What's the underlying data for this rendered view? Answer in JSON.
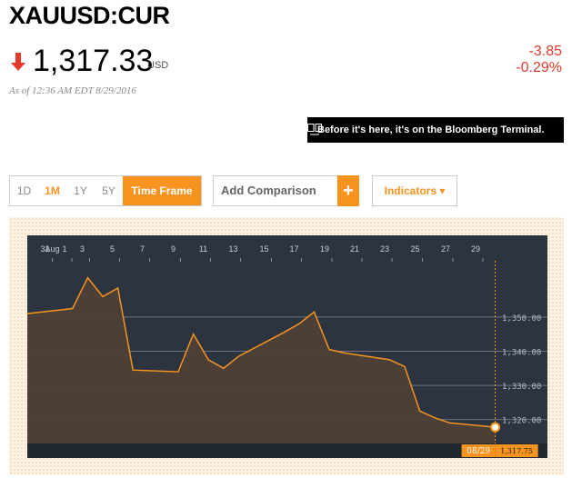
{
  "ticker": "XAUUSD:CUR",
  "price": "1,317.33",
  "currency": "USD",
  "change": "-3.85",
  "change_pct": "-0.29%",
  "as_of": "As of 12:36 AM EDT 8/29/2016",
  "promo": {
    "text": "Before it's here, it's on the Bloomberg Terminal."
  },
  "ranges": [
    "1D",
    "1M",
    "1Y",
    "5Y"
  ],
  "active_range": "1M",
  "time_frame_label": "Time Frame",
  "comparison": {
    "placeholder": "Add Comparison"
  },
  "plus_label": "+",
  "indicators_label": "Indicators ▾",
  "colors": {
    "accent": "#f7931e",
    "down": "#e33a2c",
    "plot_bg": "#2c3440",
    "area": "#4d4037"
  },
  "chart_data": {
    "type": "area",
    "x_tick_labels": [
      "31",
      "Aug",
      "1",
      "3",
      "5",
      "7",
      "9",
      "11",
      "13",
      "15",
      "17",
      "19",
      "21",
      "23",
      "25",
      "27",
      "29"
    ],
    "y_tick_labels": [
      "1,350.00",
      "1,340.00",
      "1,330.00",
      "1,320.00"
    ],
    "ylim": [
      1313,
      1367
    ],
    "x": [
      "07/29",
      "08/01",
      "08/02",
      "08/03",
      "08/04",
      "08/05",
      "08/08",
      "08/09",
      "08/10",
      "08/11",
      "08/12",
      "08/15",
      "08/16",
      "08/17",
      "08/18",
      "08/19",
      "08/22",
      "08/23",
      "08/24",
      "08/25",
      "08/26",
      "08/29"
    ],
    "values": [
      1351,
      1352.5,
      1361.5,
      1356,
      1358.5,
      1334.5,
      1334,
      1345,
      1337.5,
      1335,
      1338.5,
      1345.5,
      1348,
      1351.5,
      1340.5,
      1339.5,
      1337.5,
      1335.5,
      1322.5,
      1320.5,
      1319,
      1317.75
    ],
    "last": {
      "date": "08/29",
      "value": "1,317.75"
    },
    "grid": true
  }
}
